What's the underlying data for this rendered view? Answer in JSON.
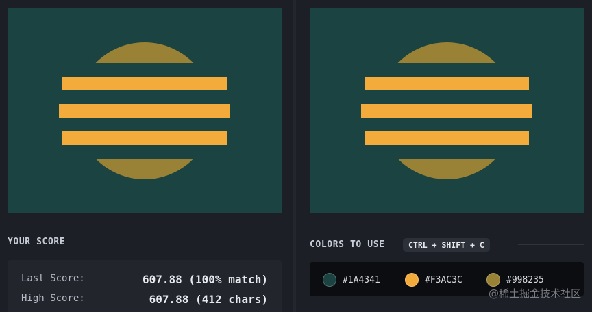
{
  "colors": {
    "dark": "#1A4341",
    "gold": "#F3AC3C",
    "olive": "#998235"
  },
  "score": {
    "title": "YOUR SCORE",
    "last_label": "Last Score:",
    "last_value": "607.88 (100% match)",
    "high_label": "High Score:",
    "high_value": "607.88 (412 chars)"
  },
  "palette": {
    "title": "COLORS TO USE",
    "shortcut": "CTRL + SHIFT + C",
    "swatches": [
      {
        "hex": "#1A4341",
        "icon": "color-swatch-dark-teal"
      },
      {
        "hex": "#F3AC3C",
        "icon": "color-swatch-gold"
      },
      {
        "hex": "#998235",
        "icon": "color-swatch-olive"
      }
    ]
  },
  "watermark": "@稀土掘金技术社区"
}
